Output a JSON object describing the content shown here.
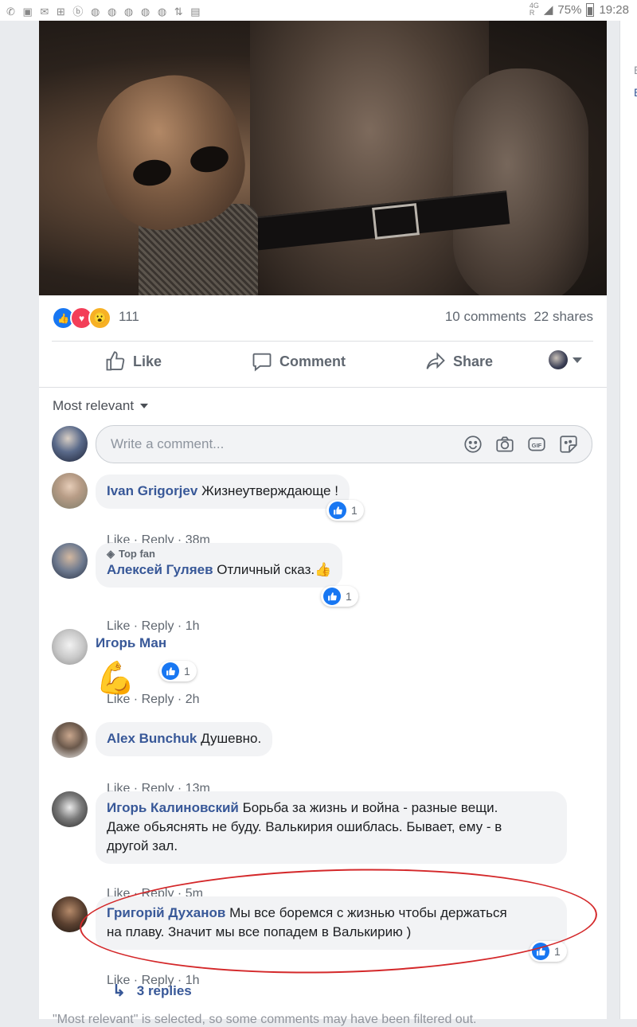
{
  "status_bar": {
    "notification_icons": "✆ ▣ ✉ ⊞ ⓑ ◍ ◍ ◍ ◍ ◍ ⇅ ▤",
    "network": "4G",
    "roaming": "R",
    "battery": "75%",
    "time": "19:28"
  },
  "post": {
    "reaction_count": "111",
    "comments_count": "10 comments",
    "shares_count": "22 shares",
    "reaction_types": [
      "like",
      "love",
      "wow"
    ]
  },
  "actions": {
    "like_label": "Like",
    "comment_label": "Comment",
    "share_label": "Share"
  },
  "sort": {
    "label": "Most relevant"
  },
  "composer": {
    "placeholder": "Write a comment..."
  },
  "comments": [
    {
      "author": "Ivan Grigorjev",
      "text": "Жизнеутверждающе !",
      "likes": "1",
      "like_label": "Like",
      "reply_label": "Reply",
      "time": "38m"
    },
    {
      "badge": "Top fan",
      "author": "Алексей Гуляев",
      "text": "Отличный сказ.",
      "emoji": "👍",
      "likes": "1",
      "like_label": "Like",
      "reply_label": "Reply",
      "time": "1h"
    },
    {
      "author": "Игорь Ман",
      "emoji": "💪",
      "likes": "1",
      "like_label": "Like",
      "reply_label": "Reply",
      "time": "2h"
    },
    {
      "author": "Alex Bunchuk",
      "text": "Душевно.",
      "like_label": "Like",
      "reply_label": "Reply",
      "time": "13m"
    },
    {
      "author": "Игорь Калиновский",
      "text_line1": "Борьба за жизнь и война - разные вещи.",
      "text_line2": "Даже обьяснять не буду. Валькирия ошиблась. Бывает, ему - в",
      "text_line3": "другой зал.",
      "like_label": "Like",
      "reply_label": "Reply",
      "time": "5m"
    },
    {
      "author": "Григорій Духанов",
      "text_line1": "Мы все боремся с жизнью чтобы держаться",
      "text_line2": "на плаву. Значит мы все попадем в Валькирию )",
      "likes": "1",
      "like_label": "Like",
      "reply_label": "Reply",
      "time": "1h",
      "replies_label": "3 replies"
    }
  ],
  "footer_note": "\"Most relevant\" is selected, so some comments may have been filtered out.",
  "side_panel": {
    "line1": "E",
    "line2": "E"
  },
  "colors": {
    "link": "#385898",
    "like_blue": "#1877f2",
    "annotation_red": "#d4282a"
  }
}
